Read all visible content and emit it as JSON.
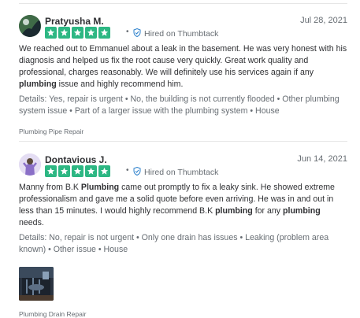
{
  "reviews": [
    {
      "name": "Pratyusha M.",
      "date": "Jul 28, 2021",
      "rating": 5,
      "hired_label": "Hired on Thumbtack",
      "body": [
        {
          "t": "We reached out to Emmanuel about a leak in the basement. He was very honest with his diagnosis and helped us fix the root cause very quickly. Great work quality and professional, charges reasonably. We will definitely use his services again if any ",
          "b": false
        },
        {
          "t": "plumbing",
          "b": true
        },
        {
          "t": " issue and highly recommend him.",
          "b": false
        }
      ],
      "details": "Details: Yes, repair is urgent • No, the building is not currently flooded • Other plumbing system issue • Part of a larger issue with the plumbing system • House",
      "tag": "Plumbing Pipe Repair"
    },
    {
      "name": "Dontavious J.",
      "date": "Jun 14, 2021",
      "rating": 5,
      "hired_label": "Hired on Thumbtack",
      "body": [
        {
          "t": "Manny from B.K ",
          "b": false
        },
        {
          "t": "Plumbing",
          "b": true
        },
        {
          "t": " came out promptly to fix a leaky sink. He showed extreme professionalism and gave me a solid quote before even arriving. He was in and out in less than 15 minutes. I would highly recommend B.K ",
          "b": false
        },
        {
          "t": "plumbing",
          "b": true
        },
        {
          "t": " for any ",
          "b": false
        },
        {
          "t": "plumbing",
          "b": true
        },
        {
          "t": " needs.",
          "b": false
        }
      ],
      "details": "Details: No, repair is not urgent • Only one drain has issues • Leaking (problem area known) • Other issue • House",
      "tag": "Plumbing Drain Repair"
    }
  ],
  "colors": {
    "star_green": "#2db783",
    "secondary_text": "#676d73",
    "divider": "#e6e6e6",
    "shield_blue": "#2a7fcb"
  },
  "icons": {
    "star": "star-icon",
    "hired": "shield-check-icon"
  }
}
